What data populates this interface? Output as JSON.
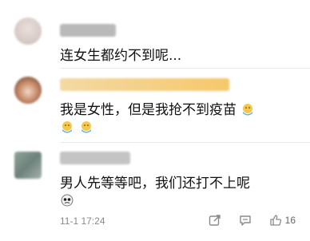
{
  "comments": [
    {
      "text": "连女生都约不到呢..."
    },
    {
      "text": "我是女性，但是我抢不到疫苗"
    },
    {
      "text": "男人先等等吧，我们还打不上呢"
    }
  ],
  "footer": {
    "time": "11-1 17:24",
    "like_count": "16"
  },
  "icons": [
    "share-icon",
    "comment-icon",
    "like-icon",
    "emoji-icon"
  ],
  "colors": {
    "meta": "#8a8a8a",
    "text": "#111111",
    "emoji_yellow": "#F5C84C",
    "emoji_blue": "#5BB4E6"
  }
}
